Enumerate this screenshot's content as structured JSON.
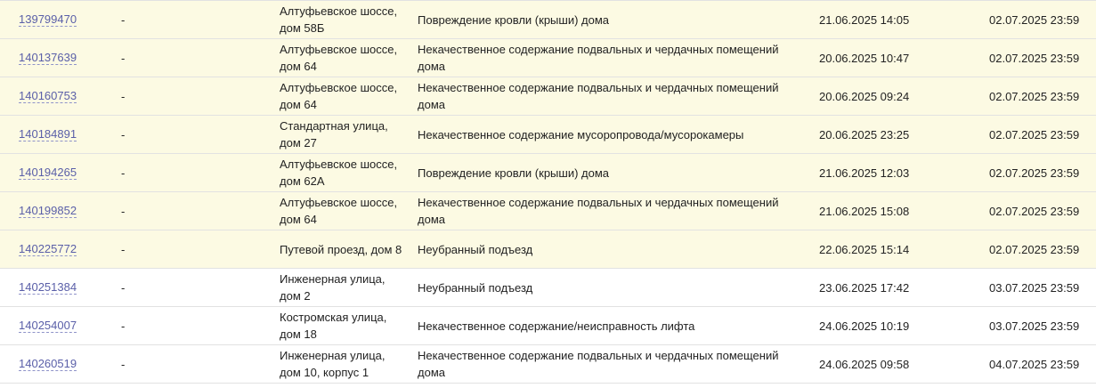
{
  "rows": [
    {
      "id": "139799470",
      "dash": "-",
      "address": "Алтуфьевское шоссе, дом 58Б",
      "description": "Повреждение кровли (крыши) дома",
      "created": "21.06.2025 14:05",
      "deadline": "02.07.2025 23:59"
    },
    {
      "id": "140137639",
      "dash": "-",
      "address": "Алтуфьевское шоссе, дом 64",
      "description": "Некачественное содержание подвальных и чердачных помещений дома",
      "created": "20.06.2025 10:47",
      "deadline": "02.07.2025 23:59"
    },
    {
      "id": "140160753",
      "dash": "-",
      "address": "Алтуфьевское шоссе, дом 64",
      "description": "Некачественное содержание подвальных и чердачных помещений дома",
      "created": "20.06.2025 09:24",
      "deadline": "02.07.2025 23:59"
    },
    {
      "id": "140184891",
      "dash": "-",
      "address": "Стандартная улица, дом 27",
      "description": "Некачественное содержание мусоропровода/мусорокамеры",
      "created": "20.06.2025 23:25",
      "deadline": "02.07.2025 23:59"
    },
    {
      "id": "140194265",
      "dash": "-",
      "address": "Алтуфьевское шоссе, дом 62А",
      "description": "Повреждение кровли (крыши) дома",
      "created": "21.06.2025 12:03",
      "deadline": "02.07.2025 23:59"
    },
    {
      "id": "140199852",
      "dash": "-",
      "address": "Алтуфьевское шоссе, дом 64",
      "description": "Некачественное содержание подвальных и чердачных помещений дома",
      "created": "21.06.2025 15:08",
      "deadline": "02.07.2025 23:59"
    },
    {
      "id": "140225772",
      "dash": "-",
      "address": "Путевой проезд, дом 8",
      "description": "Неубранный подъезд",
      "created": "22.06.2025 15:14",
      "deadline": "02.07.2025 23:59"
    },
    {
      "id": "140251384",
      "dash": "-",
      "address": "Инженерная улица, дом 2",
      "description": "Неубранный подъезд",
      "created": "23.06.2025 17:42",
      "deadline": "03.07.2025 23:59"
    },
    {
      "id": "140254007",
      "dash": "-",
      "address": "Костромская улица, дом 18",
      "description": "Некачественное содержание/неисправность лифта",
      "created": "24.06.2025 10:19",
      "deadline": "03.07.2025 23:59"
    },
    {
      "id": "140260519",
      "dash": "-",
      "address": "Инженерная улица, дом 10, корпус 1",
      "description": "Некачественное содержание подвальных и чердачных помещений дома",
      "created": "24.06.2025 09:58",
      "deadline": "04.07.2025 23:59"
    }
  ],
  "colors": {
    "highlight_row": "#fcfae3",
    "link": "#5a5fa8",
    "divider": "#e2e2e2"
  }
}
